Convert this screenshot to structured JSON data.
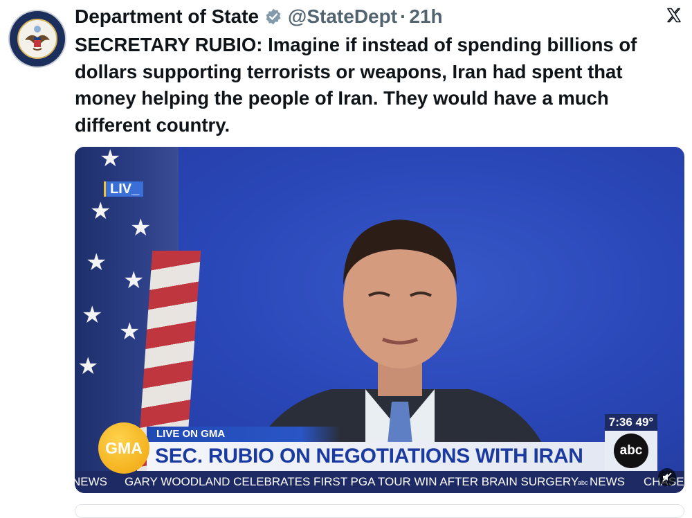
{
  "post": {
    "author_name": "Department of State",
    "handle": "@StateDept",
    "separator": "·",
    "time": "21h",
    "avatar_icon": "department-of-state-seal",
    "verified_icon": "verified-badge-icon",
    "text": "SECRETARY RUBIO: Imagine if instead of spending billions of dollars supporting terrorists or weapons, Iran had spent that money helping the people of Iran. They would have a much different country."
  },
  "platform": {
    "logo_icon": "x-logo-icon"
  },
  "video": {
    "live_badge": "LIV_",
    "program_label": "LIVE ON GMA",
    "gma_logo": "GMA",
    "headline": "SEC. RUBIO ON NEGOTIATIONS WITH IRAN",
    "time_temp": "7:36  49°",
    "network_logo": "abc",
    "ticker": {
      "left_fragment": "NEWS",
      "story": "GARY WOODLAND CELEBRATES FIRST PGA TOUR WIN AFTER BRAIN SURGERY",
      "brand": "NEWS",
      "sponsor": "CHASE"
    },
    "mute_icon": "muted-speaker-icon"
  },
  "colors": {
    "text_primary": "#0f1419",
    "text_secondary": "#536471",
    "verified_gray": "#829aab",
    "background_blue": "#2a47b8",
    "gma_yellow": "#f4b21f",
    "headline_blue": "#1a3aa0",
    "ticker_navy": "#1d2a63"
  }
}
